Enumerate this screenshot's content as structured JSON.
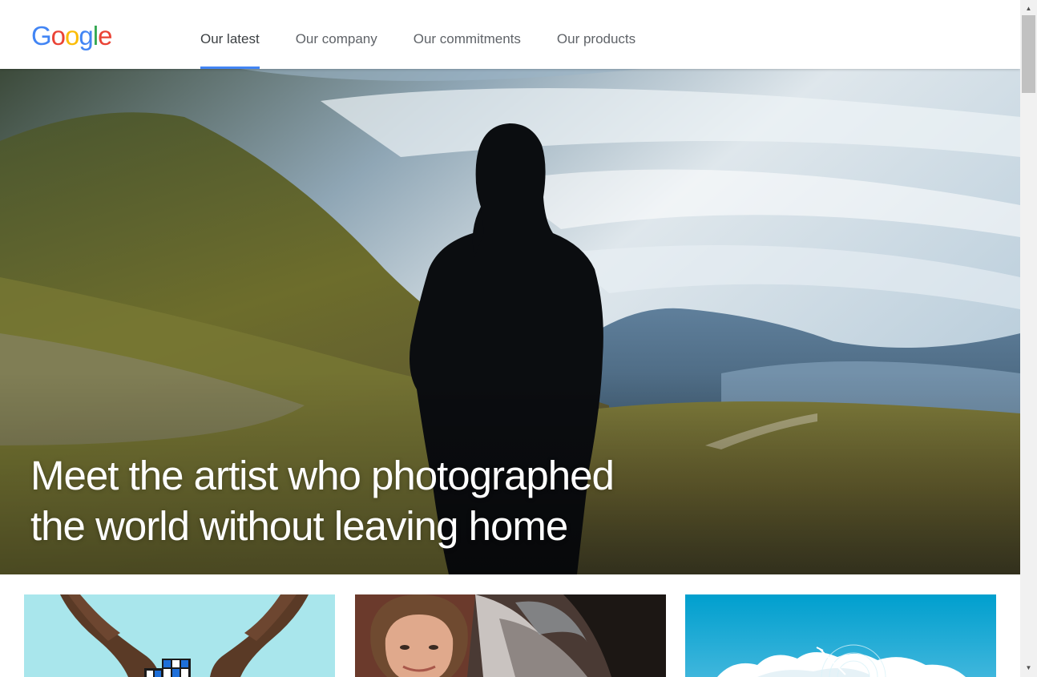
{
  "logo": {
    "letters": [
      {
        "char": "G",
        "color": "#4285f4"
      },
      {
        "char": "o",
        "color": "#ea4335"
      },
      {
        "char": "o",
        "color": "#fbbc05"
      },
      {
        "char": "g",
        "color": "#4285f4"
      },
      {
        "char": "l",
        "color": "#34a853"
      },
      {
        "char": "e",
        "color": "#ea4335"
      }
    ]
  },
  "nav": {
    "items": [
      {
        "label": "Our latest",
        "active": true
      },
      {
        "label": "Our company",
        "active": false
      },
      {
        "label": "Our commitments",
        "active": false
      },
      {
        "label": "Our products",
        "active": false
      }
    ],
    "active_color": "#4285f4"
  },
  "hero": {
    "title_line1": "Meet the artist who photographed",
    "title_line2": "the world without leaving home",
    "image": "silhouette-of-woman-in-front-of-mountain-landscape-projection"
  },
  "cards": [
    {
      "image": "hands-holding-rubiks-cube"
    },
    {
      "image": "smiling-woman-portrait"
    },
    {
      "image": "blue-sky-clouds-with-satellite-graphic"
    }
  ],
  "scrollbar": {
    "up_icon": "up-arrow-icon",
    "down_icon": "down-arrow-icon"
  }
}
